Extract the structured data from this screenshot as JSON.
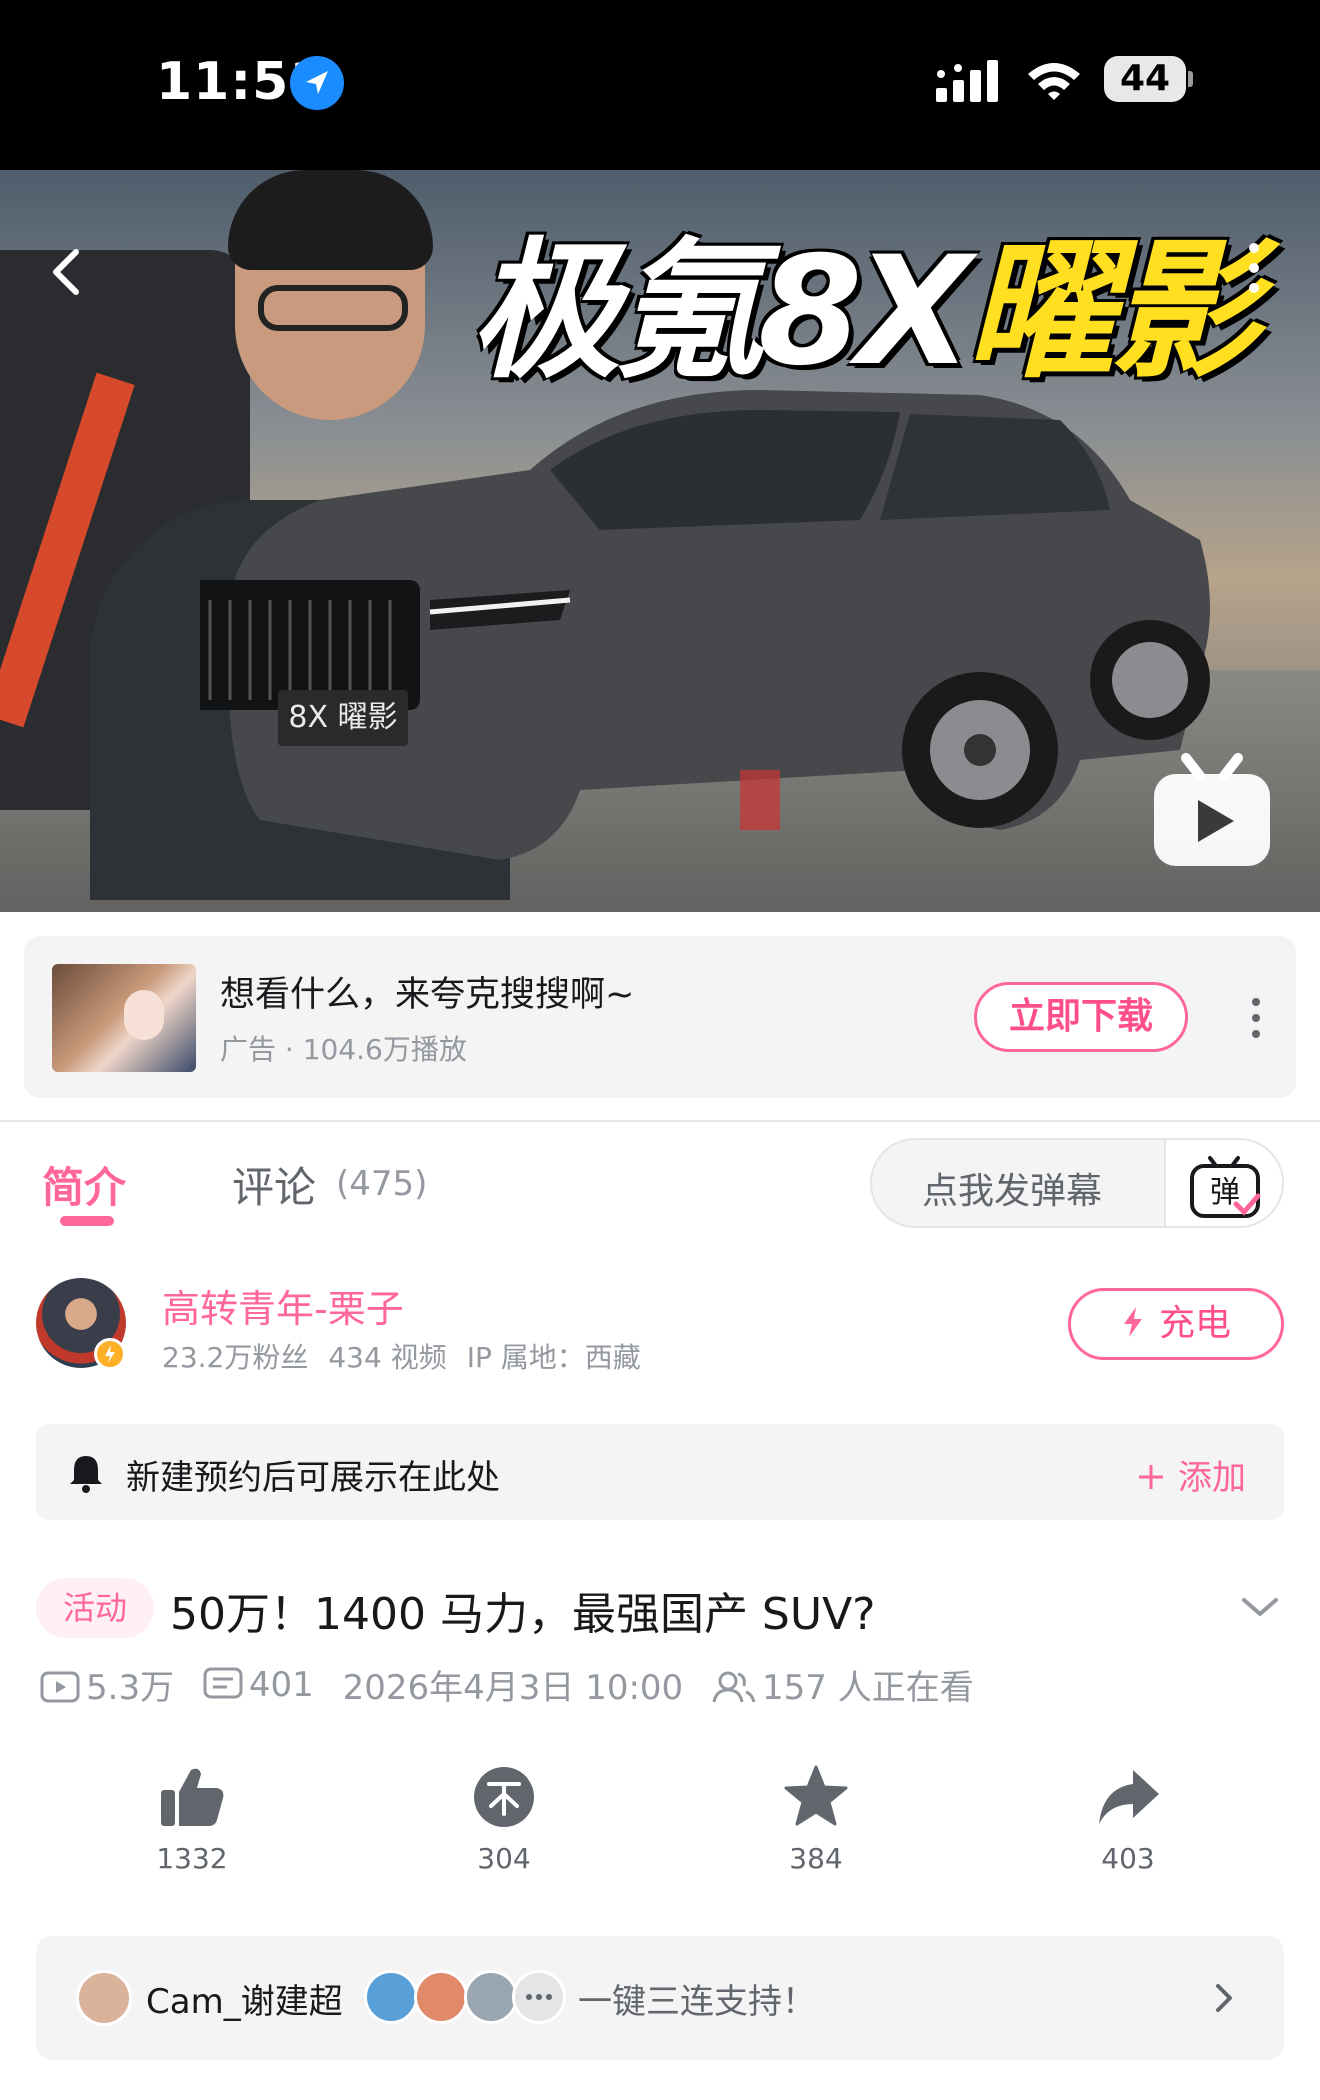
{
  "status": {
    "time": "11:51",
    "battery": "44"
  },
  "video": {
    "title_white": "极氪8X",
    "title_yellow": "曜影",
    "badge_text": "8X 曜影"
  },
  "ad": {
    "title": "想看什么，来夸克搜搜啊~",
    "subtitle": "广告 · 104.6万播放",
    "button": "立即下载"
  },
  "tabs": {
    "intro": "简介",
    "comments": "评论",
    "comments_count": "(475)"
  },
  "danmaku": {
    "placeholder": "点我发弹幕",
    "icon_char": "弹"
  },
  "uploader": {
    "name": "高转青年-栗子",
    "fans": "23.2万粉丝",
    "videos": "434 视频",
    "ip": "IP 属地：西藏",
    "charge_label": "充电"
  },
  "reservation": {
    "text": "新建预约后可展示在此处",
    "add_label": "添加"
  },
  "title_row": {
    "tag": "活动",
    "title": "50万！1400 马力，最强国产 SUV?"
  },
  "stats": {
    "plays": "5.3万",
    "danmaku": "401",
    "date": "2026年4月3日 10:00",
    "watching": "157 人正在看"
  },
  "actions": {
    "like": "1332",
    "coin": "304",
    "favorite": "384",
    "share": "403"
  },
  "triple": {
    "user": "Cam_谢建超",
    "text": "一键三连支持！"
  },
  "colors": {
    "accent": "#ff6699",
    "text_primary": "#18191c",
    "text_secondary": "#9499a0",
    "status_bar": "#000000",
    "title_yellow": "#ffdf1f"
  }
}
